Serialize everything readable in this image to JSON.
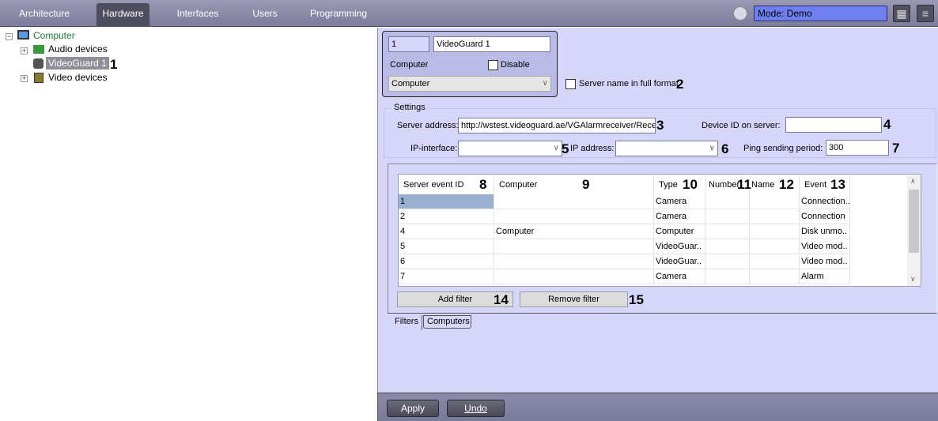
{
  "topbar": {
    "tabs": [
      {
        "label": "Architecture"
      },
      {
        "label": "Hardware"
      },
      {
        "label": "Interfaces"
      },
      {
        "label": "Users"
      },
      {
        "label": "Programming"
      }
    ],
    "active_tab": "Hardware",
    "mode": "Mode: Demo"
  },
  "tree": {
    "root": "Computer",
    "children": [
      {
        "label": "Audio devices"
      },
      {
        "label": "VideoGuard 1"
      },
      {
        "label": "Video devices"
      }
    ]
  },
  "object": {
    "id": "1",
    "name": "VideoGuard 1",
    "parent_label": "Computer",
    "disable_label": "Disable",
    "parent_value": "Computer",
    "server_full_name_label": "Server name in full format"
  },
  "settings": {
    "title": "Settings",
    "server_address_label": "Server address:",
    "server_address": "http://wstest.videoguard.ae/VGAlarmreceiver/Rece",
    "device_id_label": "Device ID on server:",
    "device_id": "",
    "ip_interface_label": "IP-interface:",
    "ip_address_label": "IP address:",
    "ping_label": "Ping sending period:",
    "ping_value": "300"
  },
  "table": {
    "columns": [
      "Server event ID",
      "Computer",
      "Type",
      "Number",
      "Name",
      "Event"
    ],
    "rows": [
      [
        "1",
        "",
        "Camera",
        "",
        "",
        "Connection.."
      ],
      [
        "2",
        "",
        "Camera",
        "",
        "",
        "Connection"
      ],
      [
        "4",
        "Computer",
        "Computer",
        "",
        "",
        "Disk unmo.."
      ],
      [
        "5",
        "",
        "VideoGuar..",
        "",
        "",
        "Video mod.."
      ],
      [
        "6",
        "",
        "VideoGuar..",
        "",
        "",
        "Video mod.."
      ],
      [
        "7",
        "",
        "Camera",
        "",
        "",
        "Alarm"
      ]
    ]
  },
  "buttons": {
    "add_filter": "Add filter",
    "remove_filter": "Remove filter",
    "apply": "Apply",
    "undo": "Undo"
  },
  "subtabs": [
    "Filters",
    "Computers"
  ],
  "annotations": [
    "1",
    "2",
    "3",
    "4",
    "5",
    "6",
    "7",
    "8",
    "9",
    "10",
    "11",
    "12",
    "13",
    "14",
    "15"
  ]
}
